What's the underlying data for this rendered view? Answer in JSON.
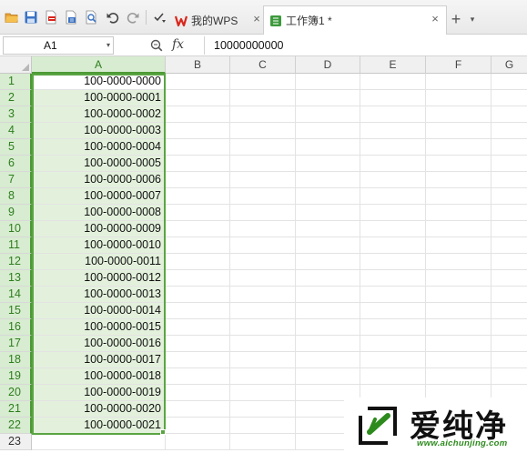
{
  "tabs": {
    "home": "我的WPS",
    "workbook": "工作簿1 *",
    "close_glyph": "×",
    "add_glyph": "+",
    "more_glyph": "▾"
  },
  "toolbar_icons": [
    "open-folder-icon",
    "save-icon",
    "export-pdf-icon",
    "print-icon",
    "print-preview-icon",
    "undo-icon",
    "redo-icon",
    "customize-icon"
  ],
  "formula_bar": {
    "name_box": "A1",
    "name_box_arrow": "▾",
    "fx_label": "fx",
    "value": "10000000000"
  },
  "grid": {
    "columns": [
      "A",
      "B",
      "C",
      "D",
      "E",
      "F",
      "G"
    ],
    "selected_column": "A",
    "rows": [
      {
        "n": "1",
        "a": "100-0000-0000"
      },
      {
        "n": "2",
        "a": "100-0000-0001"
      },
      {
        "n": "3",
        "a": "100-0000-0002"
      },
      {
        "n": "4",
        "a": "100-0000-0003"
      },
      {
        "n": "5",
        "a": "100-0000-0004"
      },
      {
        "n": "6",
        "a": "100-0000-0005"
      },
      {
        "n": "7",
        "a": "100-0000-0006"
      },
      {
        "n": "8",
        "a": "100-0000-0007"
      },
      {
        "n": "9",
        "a": "100-0000-0008"
      },
      {
        "n": "10",
        "a": "100-0000-0009"
      },
      {
        "n": "11",
        "a": "100-0000-0010"
      },
      {
        "n": "12",
        "a": "100-0000-0011"
      },
      {
        "n": "13",
        "a": "100-0000-0012"
      },
      {
        "n": "14",
        "a": "100-0000-0013"
      },
      {
        "n": "15",
        "a": "100-0000-0014"
      },
      {
        "n": "16",
        "a": "100-0000-0015"
      },
      {
        "n": "17",
        "a": "100-0000-0016"
      },
      {
        "n": "18",
        "a": "100-0000-0017"
      },
      {
        "n": "19",
        "a": "100-0000-0018"
      },
      {
        "n": "20",
        "a": "100-0000-0019"
      },
      {
        "n": "21",
        "a": "100-0000-0020"
      },
      {
        "n": "22",
        "a": "100-0000-0021"
      },
      {
        "n": "23",
        "a": ""
      }
    ]
  },
  "watermark": {
    "text": "爱纯净",
    "url": "www.aichunjing.com"
  },
  "colors": {
    "selection_green": "#5aa543",
    "selection_fill": "#e3f1dc",
    "wps_red": "#d9261c"
  }
}
